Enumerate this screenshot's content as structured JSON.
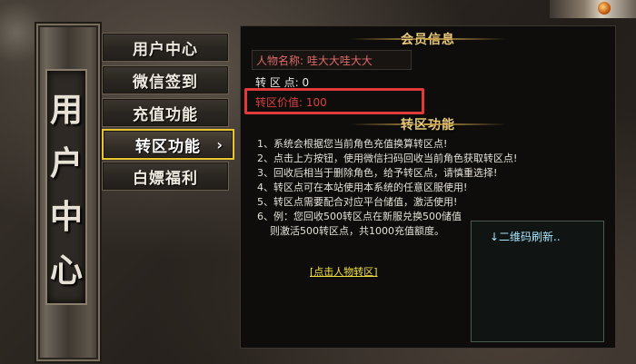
{
  "banner": {
    "chars": [
      "用",
      "户",
      "中",
      "心"
    ]
  },
  "menu": {
    "items": [
      {
        "label": "用户中心"
      },
      {
        "label": "微信签到"
      },
      {
        "label": "充值功能"
      },
      {
        "label": "转区功能",
        "arrow": "›"
      },
      {
        "label": "白嫖福利"
      }
    ],
    "active_index": 3
  },
  "member_info": {
    "title": "会员信息",
    "name_row": "人物名称: 哇大大哇大大",
    "points_row": "转 区 点: 0",
    "value_row": "转区价值: 100"
  },
  "transfer": {
    "title": "转区功能",
    "rules": [
      "1、系统会根据您当前角色充值换算转区点!",
      "2、点击上方按钮，使用微信扫码回收当前角色获取转区点!",
      "3、回收后相当于删除角色，给予转区点，请慎重选择!",
      "4、转区点可在本站使用本系统的任意区服使用!",
      "5、转区点需要配合对应平台储值，激活使用!",
      "6、例：您回收500转区点在新服兑换500储值",
      "    则激活500转区点，共1000充值额度。"
    ],
    "link_text": "[点击人物转区]",
    "qr_refresh": "↓二维码刷新.."
  },
  "colors": {
    "highlight_border": "#e6c530",
    "red_box": "#e23a3a",
    "link": "#f0e040"
  }
}
